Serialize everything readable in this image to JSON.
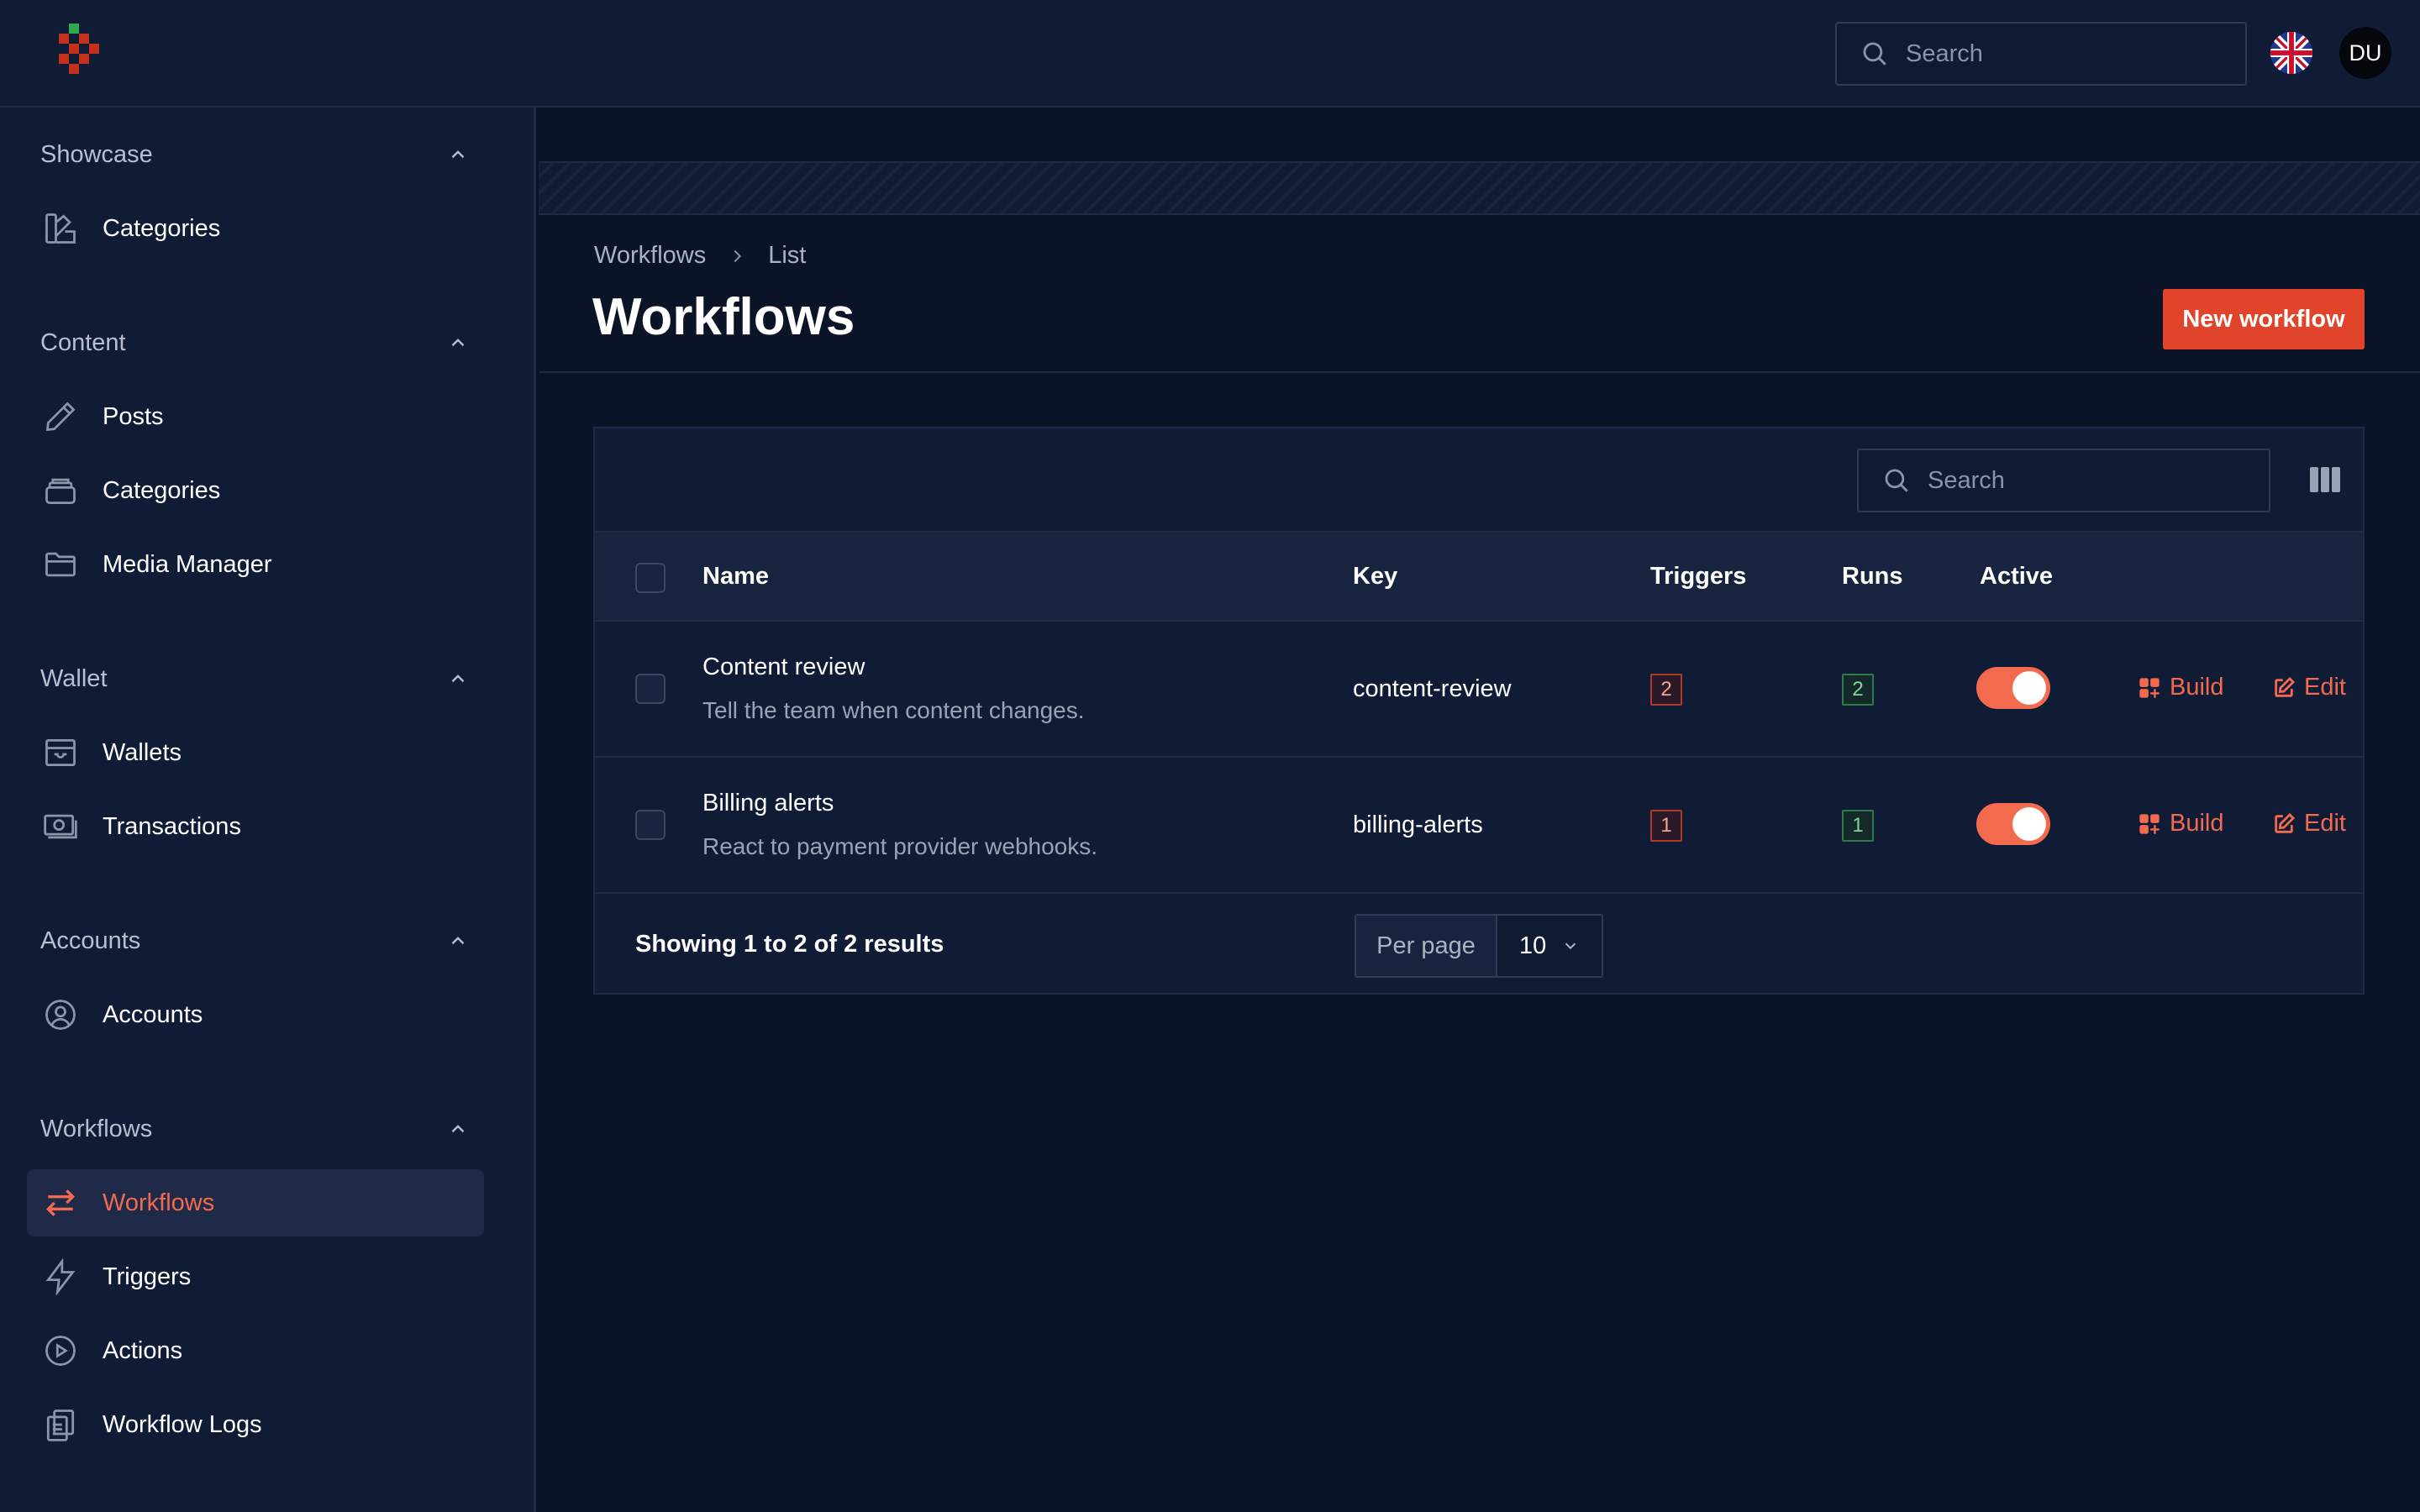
{
  "topbar": {
    "search_placeholder": "Search",
    "avatar_initials": "DU",
    "language_flag": "uk-flag-icon"
  },
  "sidebar": {
    "groups": [
      {
        "title": "Showcase",
        "items": [
          {
            "label": "Categories",
            "icon": "palette-icon"
          }
        ]
      },
      {
        "title": "Content",
        "items": [
          {
            "label": "Posts",
            "icon": "pencil-icon"
          },
          {
            "label": "Categories",
            "icon": "stack-icon"
          },
          {
            "label": "Media Manager",
            "icon": "folder-icon"
          }
        ]
      },
      {
        "title": "Wallet",
        "items": [
          {
            "label": "Wallets",
            "icon": "archive-box-icon"
          },
          {
            "label": "Transactions",
            "icon": "banknote-icon"
          }
        ]
      },
      {
        "title": "Accounts",
        "items": [
          {
            "label": "Accounts",
            "icon": "user-circle-icon"
          }
        ]
      },
      {
        "title": "Workflows",
        "items": [
          {
            "label": "Workflows",
            "icon": "arrows-exchange-icon",
            "active": true
          },
          {
            "label": "Triggers",
            "icon": "bolt-icon"
          },
          {
            "label": "Actions",
            "icon": "play-circle-icon"
          },
          {
            "label": "Workflow Logs",
            "icon": "clipboard-icon"
          }
        ]
      }
    ]
  },
  "page": {
    "breadcrumb": [
      "Workflows",
      "List"
    ],
    "title": "Workflows",
    "new_button": "New workflow"
  },
  "table": {
    "search_placeholder": "Search",
    "columns": [
      "Name",
      "Key",
      "Triggers",
      "Runs",
      "Active"
    ],
    "rows": [
      {
        "name": "Content review",
        "description": "Tell the team when content changes.",
        "key": "content-review",
        "triggers": "2",
        "runs": "2",
        "active": true,
        "build": "Build",
        "edit": "Edit"
      },
      {
        "name": "Billing alerts",
        "description": "React to payment provider webhooks.",
        "key": "billing-alerts",
        "triggers": "1",
        "runs": "1",
        "active": true,
        "build": "Build",
        "edit": "Edit"
      }
    ],
    "footer": {
      "showing": "Showing 1 to 2 of 2 results",
      "per_page_label": "Per page",
      "per_page_value": "10"
    }
  },
  "colors": {
    "background": "#0b1327",
    "panel": "#101b36",
    "accent": "#f46a4e",
    "primary_button": "#e0442a"
  }
}
